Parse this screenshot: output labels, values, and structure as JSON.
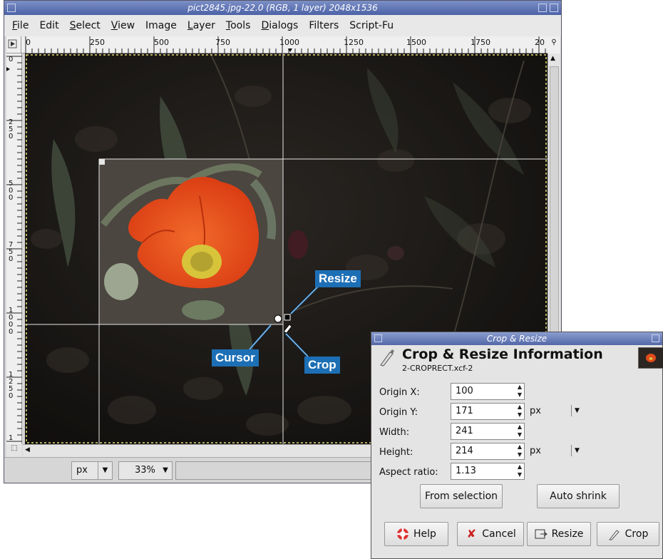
{
  "window": {
    "title": "pict2845.jpg-22.0 (RGB, 1 layer) 2048x1536"
  },
  "menubar": [
    {
      "label": "File",
      "mnemonic": "F",
      "rest": "ile"
    },
    {
      "label": "Edit",
      "mnemonic": "",
      "rest": "Edit"
    },
    {
      "label": "Select",
      "mnemonic": "S",
      "rest": "elect"
    },
    {
      "label": "View",
      "mnemonic": "V",
      "rest": "iew"
    },
    {
      "label": "Image",
      "mnemonic": "",
      "rest": "Image"
    },
    {
      "label": "Layer",
      "mnemonic": "L",
      "rest": "ayer"
    },
    {
      "label": "Tools",
      "mnemonic": "T",
      "rest": "ools"
    },
    {
      "label": "Dialogs",
      "mnemonic": "D",
      "rest": "ialogs"
    },
    {
      "label": "Filters",
      "mnemonic": "",
      "rest": "Filters"
    },
    {
      "label": "Script-Fu",
      "mnemonic": "",
      "rest": "Script-Fu"
    }
  ],
  "ruler_h": {
    "labels": [
      "0",
      "250",
      "500",
      "750",
      "1000",
      "1250",
      "1500",
      "1750",
      "20"
    ]
  },
  "ruler_v": {
    "labels": [
      "0",
      "250",
      "500",
      "750",
      "1000",
      "1250",
      "1"
    ]
  },
  "statusbar": {
    "unit": "px",
    "zoom": "33%"
  },
  "callouts": {
    "resize": "Resize",
    "cursor": "Cursor",
    "crop": "Crop"
  },
  "dialog": {
    "window_title": "Crop & Resize",
    "heading": "Crop & Resize Information",
    "subtitle": "2-CROPRECT.xcf-2",
    "fields": {
      "origin_x": {
        "label": "Origin X:",
        "value": "100"
      },
      "origin_y": {
        "label": "Origin Y:",
        "value": "171",
        "unit": "px"
      },
      "width": {
        "label": "Width:",
        "value": "241"
      },
      "height": {
        "label": "Height:",
        "value": "214",
        "unit": "px"
      },
      "aspect": {
        "label": "Aspect ratio:",
        "value": "1.13"
      }
    },
    "buttons": {
      "from_selection": "From selection",
      "auto_shrink": "Auto shrink",
      "help": "Help",
      "cancel": "Cancel",
      "resize": "Resize",
      "crop": "Crop"
    }
  },
  "colors": {
    "titlebar": "#5a6fb0",
    "callout": "#1d6fb5",
    "flower": "#ec4a1e"
  }
}
